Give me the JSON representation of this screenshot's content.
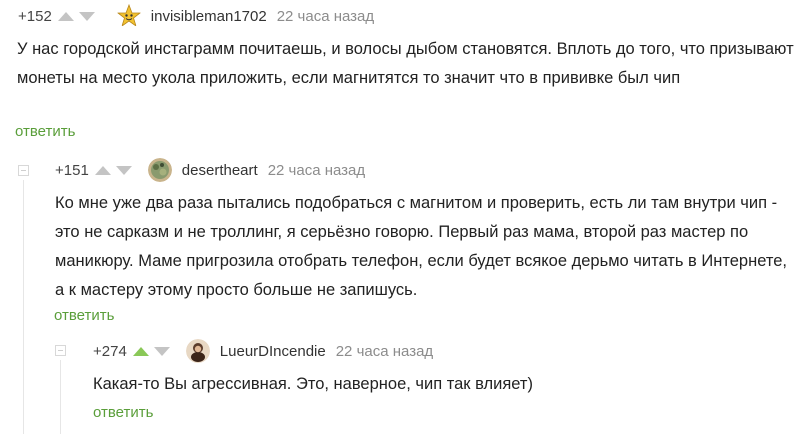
{
  "comments": [
    {
      "rating": "+152",
      "username": "invisibleman1702",
      "time": "22 часа назад",
      "text": "У нас городской инстаграмм почитаешь, и волосы дыбом становятся. Вплоть до того, что призывают монеты на место укола приложить, если магнитятся то значит что в прививке был чип",
      "reply_label": "ответить"
    },
    {
      "rating": "+151",
      "username": "desertheart",
      "time": "22 часа назад",
      "text": "Ко мне уже два раза пытались подобраться с магнитом и проверить, есть ли там внутри чип - это не сарказм и не троллинг, я серьёзно говорю. Первый раз мама, второй раз мастер по маникюру. Маме пригрозила отобрать телефон, если будет всякое дерьмо читать в Интернете, а к мастеру этому просто больше не запишусь.",
      "reply_label": "ответить"
    },
    {
      "rating": "+274",
      "username": "LueurDIncendie",
      "time": "22 часа назад",
      "text": "Какая-то Вы агрессивная. Это, наверное, чип так влияет)",
      "reply_label": "ответить",
      "upvoted": true
    }
  ]
}
